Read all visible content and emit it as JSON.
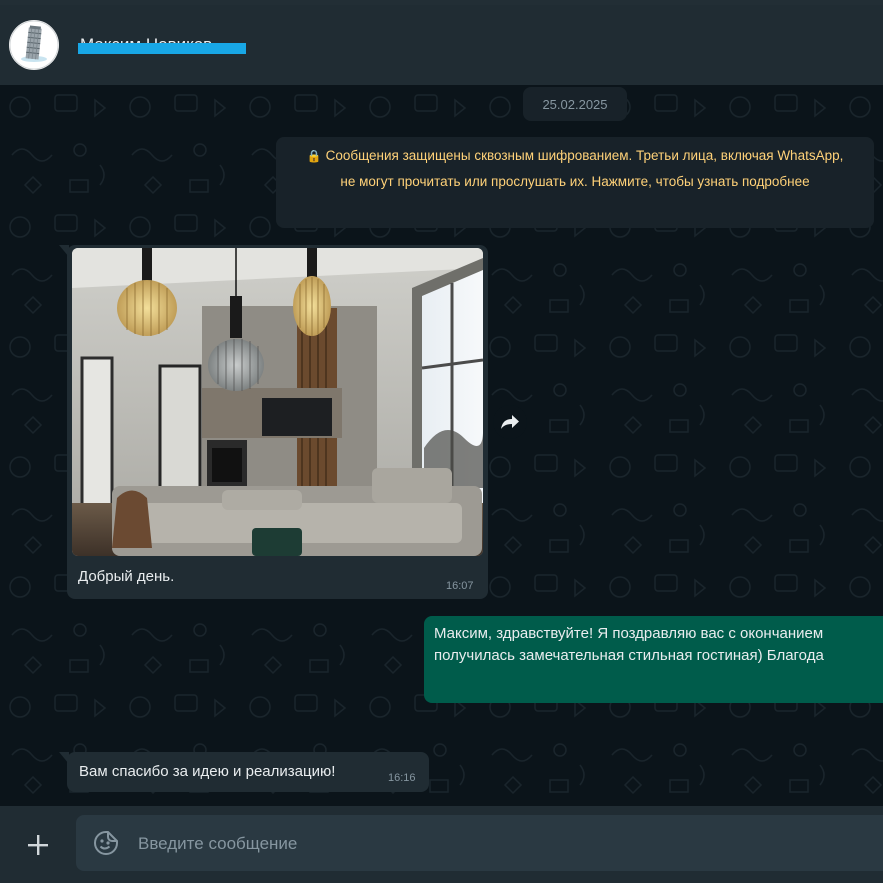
{
  "header": {
    "contact_name": "Максим Новиков",
    "avatar_icon": "leaning-tower-avatar-icon"
  },
  "chat": {
    "date_chip": "25.02.2025",
    "system_message": {
      "icon": "lock-icon",
      "text": "Сообщения защищены сквозным шифрованием. Третьи лица, включая WhatsApp, не могут прочитать или прослушать их. Нажмите, чтобы узнать подробнее"
    },
    "messages": [
      {
        "direction": "incoming",
        "type": "image",
        "caption": "Добрый день.",
        "time": "16:07"
      },
      {
        "direction": "outgoing",
        "type": "text",
        "line1": "Максим, здравствуйте! Я поздравляю вас с окончанием",
        "line2": "получилась замечательная стильная гостиная) Благода"
      },
      {
        "direction": "incoming",
        "type": "text",
        "text": "Вам спасибо за идею и реализацию!",
        "time": "16:16"
      }
    ],
    "forward_icon": "forward-icon"
  },
  "footer": {
    "attach_icon": "plus-icon",
    "emoji_icon": "emoji-icon",
    "placeholder": "Введите сообщение"
  },
  "colors": {
    "chat_background": "#0b141a",
    "panel": "#202c33",
    "incoming_bubble": "#202c33",
    "outgoing_bubble": "#005c4b",
    "system_text": "#ffd279"
  }
}
